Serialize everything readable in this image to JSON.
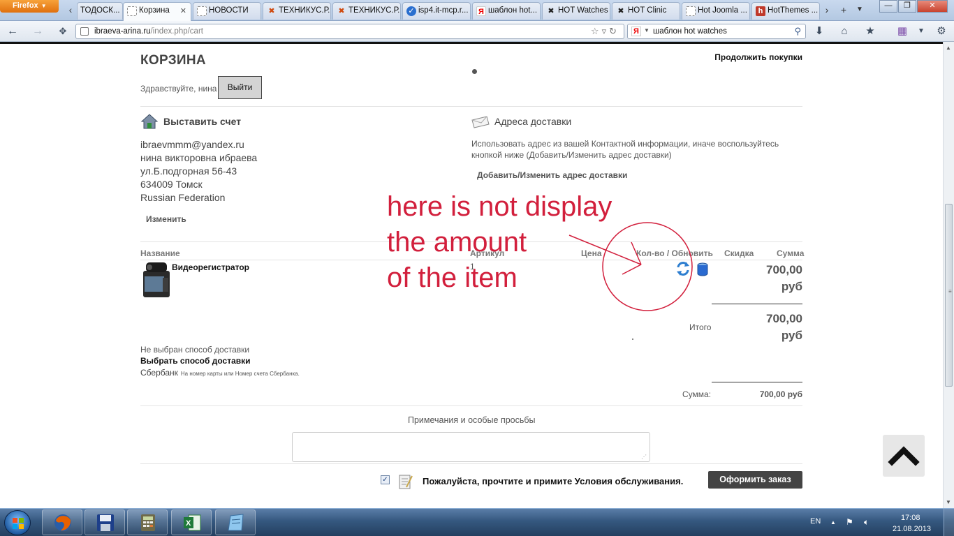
{
  "browser": {
    "app_button": "Firefox",
    "tabs": [
      {
        "label": "ТОДОСК...",
        "favicon": "page-icon"
      },
      {
        "label": "Корзина",
        "favicon": "blank-page-icon",
        "active": true
      },
      {
        "label": "НОВОСТИ",
        "favicon": "blank-page-icon"
      },
      {
        "label": "ТЕХНИКУС.Р...",
        "favicon": "joomla-icon"
      },
      {
        "label": "ТЕХНИКУС.Р...",
        "favicon": "joomla-icon"
      },
      {
        "label": "isp4.it-mcp.r...",
        "favicon": "isp-icon"
      },
      {
        "label": "шаблон hot...",
        "favicon": "yandex-icon"
      },
      {
        "label": "HOT Watches",
        "favicon": "hotthemes-x-icon"
      },
      {
        "label": "HOT Clinic",
        "favicon": "hotthemes-x-icon"
      },
      {
        "label": "Hot Joomla ...",
        "favicon": "blank-page-icon"
      },
      {
        "label": "HotThemes ...",
        "favicon": "hotthemes-h-icon"
      }
    ],
    "url_host": "ibraeva-arina.ru",
    "url_path": "/index.php/cart",
    "search_text": "шаблон hot watches",
    "downloads_badge": "0"
  },
  "cart": {
    "title": "КОРЗИНА",
    "continue_shopping": "Продолжить покупки",
    "greeting": "Здравствуйте, нина",
    "logout": "Выйти",
    "billto": {
      "title": "Выставить счет",
      "lines": [
        "ibraevmmm@yandex.ru",
        "нина викторовна ибраева",
        "ул.Б.подгорная 56-43",
        "634009 Томск",
        "Russian Federation"
      ],
      "edit": "Изменить"
    },
    "shipto": {
      "title": "Адреса доставки",
      "note": "Использовать адрес из вашей Контактной информации, иначе воспользуйтесь кнопкой ниже (Добавить/Изменить адрес доставки)",
      "change": "Добавить/Изменить адрес доставки"
    },
    "columns": {
      "name": "Название",
      "sku": "Артикул",
      "price": "Цена",
      "qty": "Кол-во / Обновить",
      "discount": "Скидка",
      "total": "Сумма"
    },
    "item": {
      "name": "Видеорегистратор",
      "sku": "1",
      "total_amount": "700,00",
      "total_currency": "руб"
    },
    "subtotal_label": "Итого",
    "subtotal_amount": "700,00",
    "subtotal_currency": "руб",
    "shipment_none": "Не выбран способ доставки",
    "shipment_choose": "Выбрать способ доставки",
    "payment_name": "Сбербанк",
    "payment_desc": "На номер карты или Номер счета Сбербанка.",
    "sum_label": "Сумма:",
    "sum_value": "700,00 руб",
    "notes_label": "Примечания и особые просьбы",
    "tos_text": "Пожалуйста, прочтите и примите Условия обслуживания.",
    "tos_checked": true,
    "checkout": "Оформить заказ"
  },
  "annotation": {
    "lines": [
      "here is not display",
      "the amount",
      "of the item"
    ],
    "color": "#d21f3c"
  },
  "taskbar": {
    "apps": [
      "firefox-icon",
      "floppy-save-icon",
      "calculator-icon",
      "excel-icon",
      "notepad-icon"
    ],
    "lang": "EN",
    "time": "17:08",
    "date": "21.08.2013"
  }
}
